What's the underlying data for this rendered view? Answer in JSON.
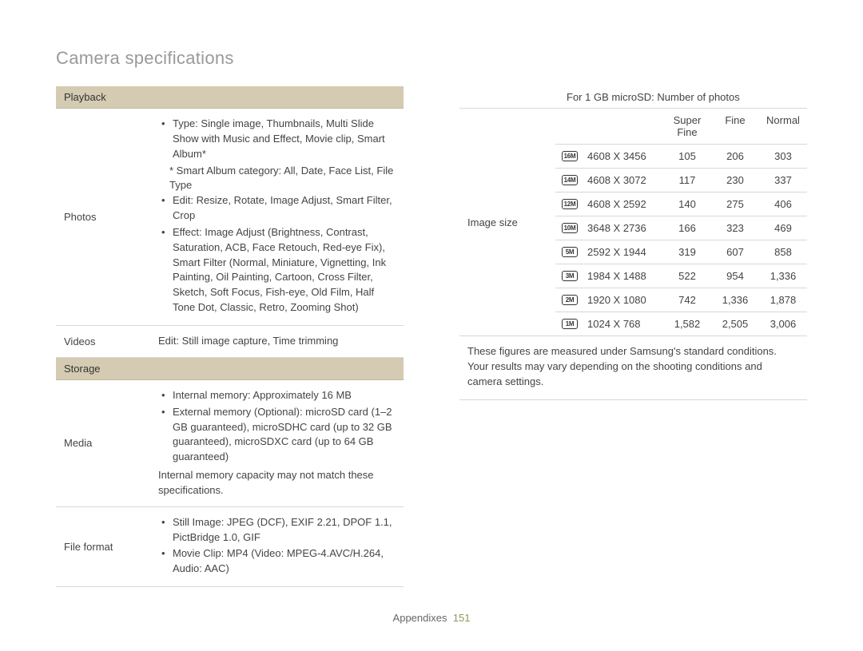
{
  "title": "Camera specifications",
  "left": {
    "sections": [
      {
        "header": "Playback"
      }
    ],
    "photos": {
      "label": "Photos",
      "bullets": [
        "Type: Single image, Thumbnails, Multi Slide Show with Music and Effect, Movie clip, Smart Album*"
      ],
      "sub": "* Smart Album category: All, Date, Face List, File Type",
      "bullets2": [
        "Edit: Resize, Rotate, Image Adjust, Smart Filter, Crop",
        "Effect: Image Adjust (Brightness, Contrast, Saturation, ACB, Face Retouch, Red-eye Fix), Smart Filter (Normal, Miniature, Vignetting, Ink Painting, Oil Painting, Cartoon, Cross Filter, Sketch, Soft Focus, Fish-eye, Old Film, Half Tone Dot, Classic, Retro, Zooming Shot)"
      ]
    },
    "videos": {
      "label": "Videos",
      "text": "Edit: Still image capture, Time trimming"
    },
    "storage_header": "Storage",
    "media": {
      "label": "Media",
      "bullets": [
        "Internal memory: Approximately 16 MB",
        "External memory (Optional): microSD card (1–2 GB guaranteed), microSDHC card (up to 32 GB guaranteed), microSDXC card (up to 64 GB guaranteed)"
      ],
      "note": "Internal memory capacity may not match these specifications."
    },
    "fileformat": {
      "label": "File format",
      "bullets": [
        "Still Image: JPEG (DCF), EXIF 2.21, DPOF 1.1, PictBridge 1.0, GIF",
        "Movie Clip: MP4 (Video: MPEG-4.AVC/H.264, Audio: AAC)"
      ]
    }
  },
  "right": {
    "caption": "For 1 GB microSD: Number of photos",
    "section_label": "Image size",
    "headers": [
      "Super Fine",
      "Fine",
      "Normal"
    ],
    "rows": [
      {
        "icon": "16M",
        "size": "4608 X 3456",
        "sf": "105",
        "f": "206",
        "n": "303"
      },
      {
        "icon": "14M",
        "size": "4608 X 3072",
        "sf": "117",
        "f": "230",
        "n": "337"
      },
      {
        "icon": "12M",
        "size": "4608 X 2592",
        "sf": "140",
        "f": "275",
        "n": "406"
      },
      {
        "icon": "10M",
        "size": "3648 X 2736",
        "sf": "166",
        "f": "323",
        "n": "469"
      },
      {
        "icon": "5M",
        "size": "2592 X 1944",
        "sf": "319",
        "f": "607",
        "n": "858"
      },
      {
        "icon": "3M",
        "size": "1984 X 1488",
        "sf": "522",
        "f": "954",
        "n": "1,336"
      },
      {
        "icon": "2M",
        "size": "1920 X 1080",
        "sf": "742",
        "f": "1,336",
        "n": "1,878"
      },
      {
        "icon": "1M",
        "size": "1024 X 768",
        "sf": "1,582",
        "f": "2,505",
        "n": "3,006"
      }
    ],
    "note": "These figures are measured under Samsung's standard conditions. Your results may vary depending on the shooting conditions and camera settings."
  },
  "footer": {
    "text": "Appendixes",
    "page": "151"
  }
}
